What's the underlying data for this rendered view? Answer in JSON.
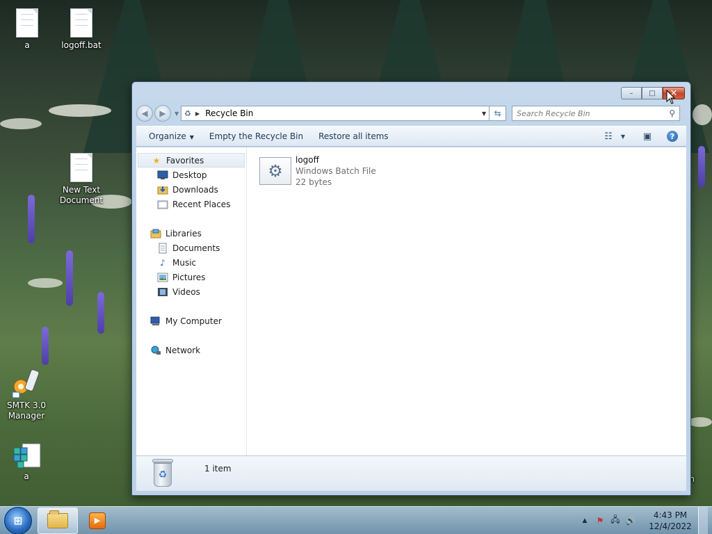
{
  "desktop": {
    "icons": [
      {
        "label": "a"
      },
      {
        "label": "logoff.bat"
      },
      {
        "label": "New Text Document"
      },
      {
        "label": "SMTK 3.0 Manager"
      },
      {
        "label": "a"
      }
    ],
    "partial_label": "in"
  },
  "window": {
    "title": "Recycle Bin",
    "caption_buttons": {
      "minimize": "–",
      "maximize": "□",
      "close": "✕"
    }
  },
  "navbar": {
    "breadcrumb": "Recycle Bin",
    "search_placeholder": "Search Recycle Bin"
  },
  "commandbar": {
    "organize": "Organize",
    "empty": "Empty the Recycle Bin",
    "restore": "Restore all items"
  },
  "nav": {
    "favorites": {
      "label": "Favorites",
      "items": [
        {
          "label": "Desktop"
        },
        {
          "label": "Downloads"
        },
        {
          "label": "Recent Places"
        }
      ]
    },
    "libraries": {
      "label": "Libraries",
      "items": [
        {
          "label": "Documents"
        },
        {
          "label": "Music"
        },
        {
          "label": "Pictures"
        },
        {
          "label": "Videos"
        }
      ]
    },
    "computer": {
      "label": "My Computer"
    },
    "network": {
      "label": "Network"
    }
  },
  "files": [
    {
      "name": "logoff",
      "type": "Windows Batch File",
      "size": "22 bytes",
      "icon": "batch-file-icon"
    }
  ],
  "details": {
    "count": "1 item"
  },
  "taskbar": {
    "time": "4:43 PM",
    "date": "12/4/2022",
    "start_glyph": "⊞"
  },
  "colors": {
    "close_button": "#c4442b",
    "accent": "#2a6cc2"
  }
}
